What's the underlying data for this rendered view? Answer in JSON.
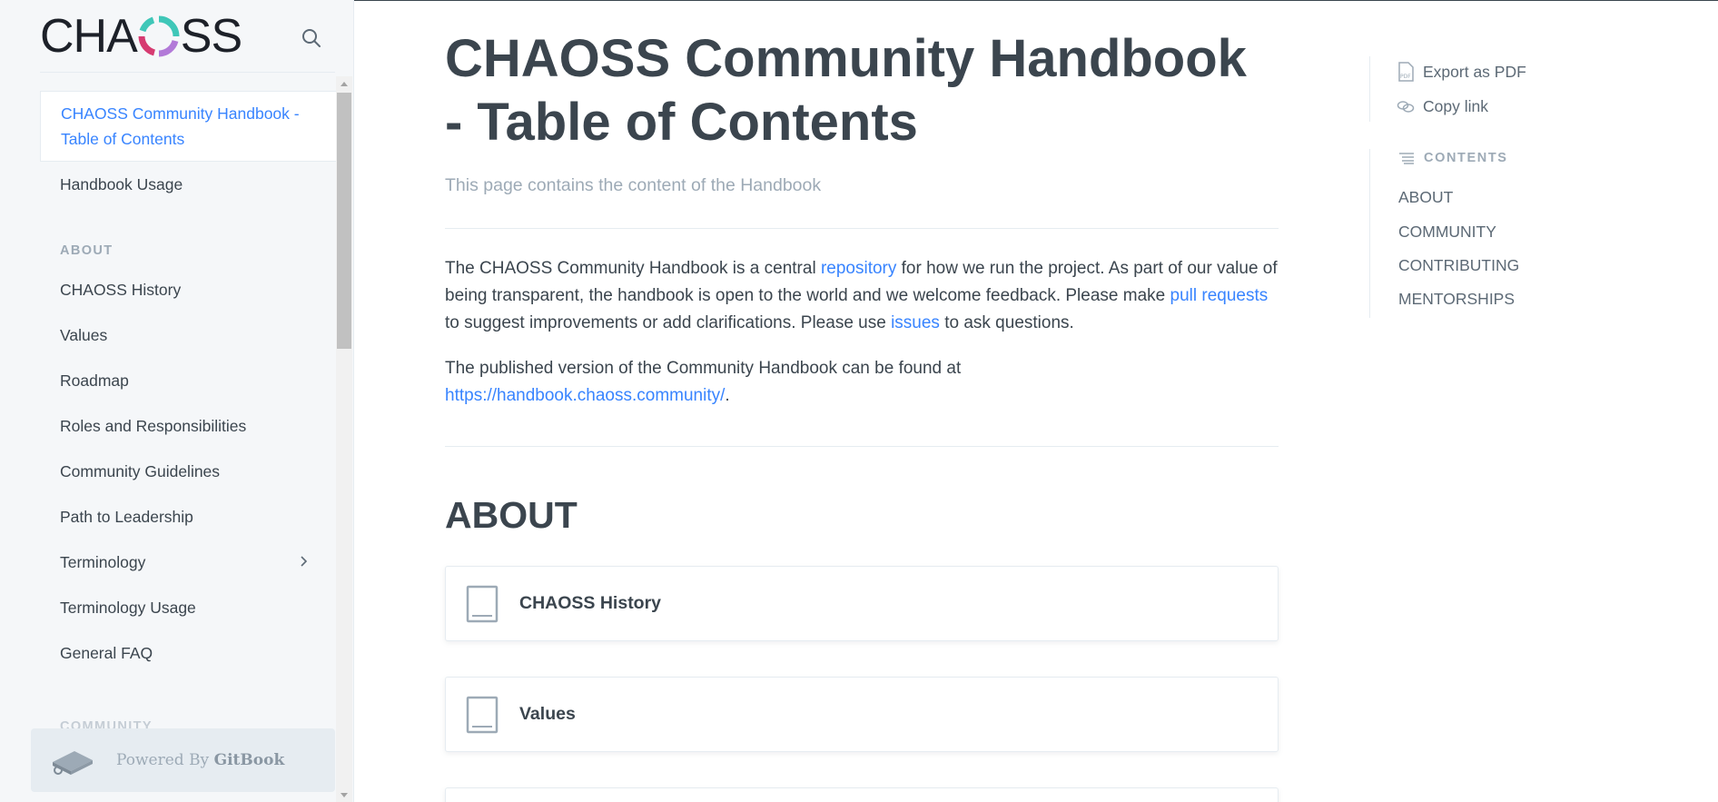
{
  "brand": {
    "logo_left": "CHA",
    "logo_right": "SS",
    "colors": {
      "ring_teal": "#3fc7b8",
      "ring_purple": "#b27ad8",
      "ring_magenta": "#d63b71",
      "link": "#3884ff",
      "text": "#3b454e",
      "muted": "#9daab6"
    }
  },
  "sidebar": {
    "search_icon": "search-icon",
    "items": [
      {
        "label": "CHAOSS Community Handbook - Table of Contents"
      },
      {
        "label": "Handbook Usage"
      }
    ],
    "section_about": "ABOUT",
    "about_items": [
      {
        "label": "CHAOSS History"
      },
      {
        "label": "Values"
      },
      {
        "label": "Roadmap"
      },
      {
        "label": "Roles and Responsibilities"
      },
      {
        "label": "Community Guidelines"
      },
      {
        "label": "Path to Leadership"
      },
      {
        "label": "Terminology"
      },
      {
        "label": "Terminology Usage"
      },
      {
        "label": "General FAQ"
      }
    ],
    "next_section": "COMMUNITY",
    "powered_prefix": "Powered By ",
    "powered_brand": "GitBook"
  },
  "main": {
    "title": "CHAOSS Community Handbook - Table of Contents",
    "subtitle": "This page contains the content of the Handbook",
    "para1": {
      "t1": "The CHAOSS Community Handbook is a central ",
      "link1": "repository",
      "t2": " for how we run the project. As part of our value of being transparent, the handbook is open to the world and we welcome feedback. Please make ",
      "link2": "pull requests",
      "t3": " to suggest improvements or add clarifications. Please use ",
      "link3": "issues",
      "t4": " to ask questions."
    },
    "para2": {
      "t1": "The published version of the Community Handbook can be found at ",
      "link": "https://handbook.chaoss.community/",
      "t2": "."
    },
    "section_heading": "ABOUT",
    "cards": [
      {
        "label": "CHAOSS History"
      },
      {
        "label": "Values"
      }
    ]
  },
  "right": {
    "export": "Export as PDF",
    "copy": "Copy link",
    "contents_label": "CONTENTS",
    "toc": [
      "ABOUT",
      "COMMUNITY",
      "CONTRIBUTING",
      "MENTORSHIPS"
    ]
  }
}
